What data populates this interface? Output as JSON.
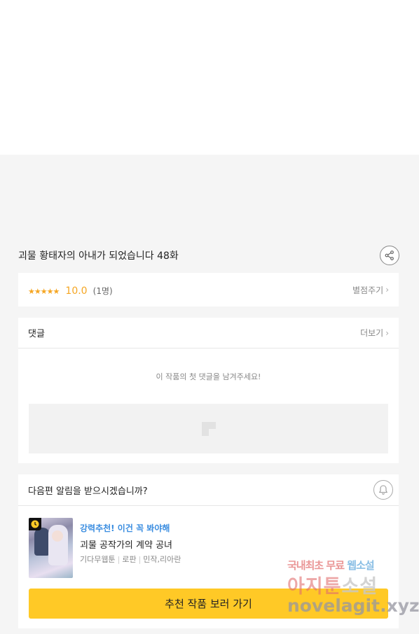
{
  "episode": {
    "title": "괴물 황태자의 아내가 되었습니다 48화"
  },
  "rating": {
    "stars": "★★★★★",
    "score": "10.0",
    "count": "(1명)",
    "rate_label": "별점주기"
  },
  "comments": {
    "header": "댓글",
    "more_label": "더보기",
    "empty_message": "이 작품의 첫 댓글을 남겨주세요!"
  },
  "notify": {
    "question": "다음편 알림을 받으시겠습니까?"
  },
  "recommend": {
    "tag": "강력추천! 이건 꼭 봐야해",
    "title": "괴물 공작가의 계약 공녀",
    "meta": [
      "기다무웹툰",
      "로판",
      "민작,리아란"
    ],
    "cta_label": "추천 작품 보러 가기"
  },
  "watermark": {
    "line1_a": "국내최초 무료",
    "line1_b": "웹소설",
    "line2_a": "아지툰",
    "line2_b": "소설",
    "line3": "novelagit.xyz"
  },
  "colors": {
    "accent_star": "#f5a623",
    "cta": "#ffc926",
    "tag_blue": "#3a8de0"
  },
  "icons": {
    "share": "share-icon",
    "bell": "bell-icon",
    "clock": "clock-icon",
    "chevron": "chevron-right-icon"
  }
}
